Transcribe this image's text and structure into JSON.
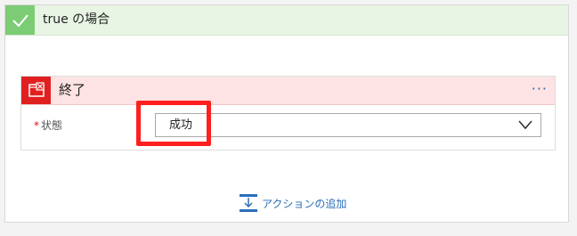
{
  "condition": {
    "title": "true の場合",
    "icon": "checkmark-icon",
    "accent_color": "#7ccc76"
  },
  "action": {
    "title": "終了",
    "icon": "terminate-icon",
    "accent_color": "#e02020",
    "more_label": "···",
    "field": {
      "required_mark": "*",
      "label": "状態",
      "value": "成功"
    }
  },
  "add_action": {
    "label": "アクションの追加",
    "icon": "add-step-icon"
  }
}
